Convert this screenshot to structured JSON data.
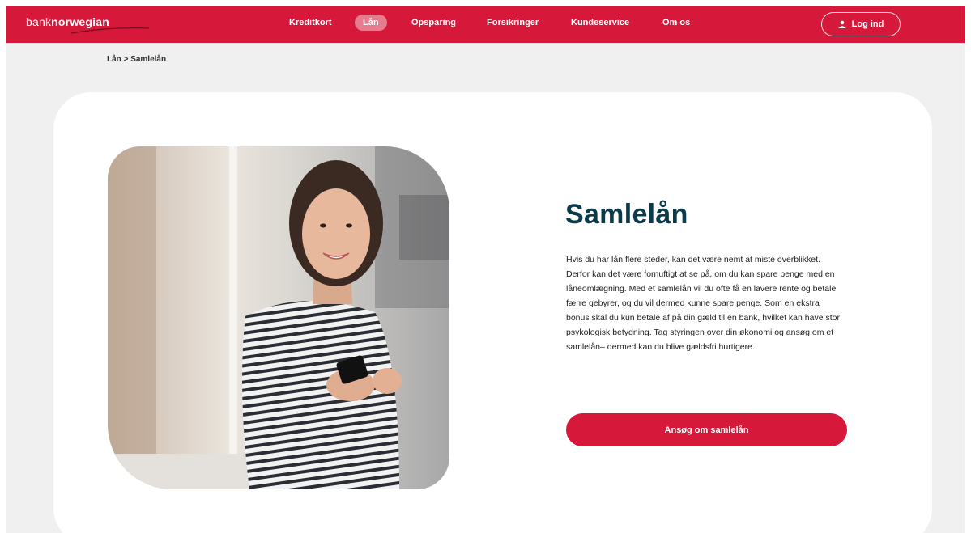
{
  "brand": {
    "logo_part1": "bank",
    "logo_part2": "norwegian",
    "primary_color": "#d6193a",
    "title_color": "#0b3a4a"
  },
  "nav": {
    "items": [
      {
        "label": "Kreditkort",
        "active": false
      },
      {
        "label": "Lån",
        "active": true
      },
      {
        "label": "Opsparing",
        "active": false
      },
      {
        "label": "Forsikringer",
        "active": false
      },
      {
        "label": "Kundeservice",
        "active": false
      },
      {
        "label": "Om os",
        "active": false
      }
    ],
    "login_label": "Log ind",
    "login_icon": "user-icon"
  },
  "breadcrumb": {
    "parent": "Lån",
    "separator": ">",
    "current": "Samlelån"
  },
  "hero": {
    "title": "Samlelån",
    "body": "Hvis du har lån flere steder, kan det være nemt at miste overblikket. Derfor kan det være fornuftigt at se på, om du kan spare penge med en låneomlægning. Med et samlelån vil du ofte få en lavere rente og betale færre gebyrer, og du vil dermed kunne spare penge. Som en ekstra bonus skal du kun betale af på din gæld til én bank, hvilket kan have stor psykologisk betydning. Tag styringen over din økonomi og ansøg om et samlelån– dermed kan du blive gældsfri hurtigere.",
    "cta_label": "Ansøg om samlelån",
    "image_description_icon": "woman-with-phone-photo"
  }
}
